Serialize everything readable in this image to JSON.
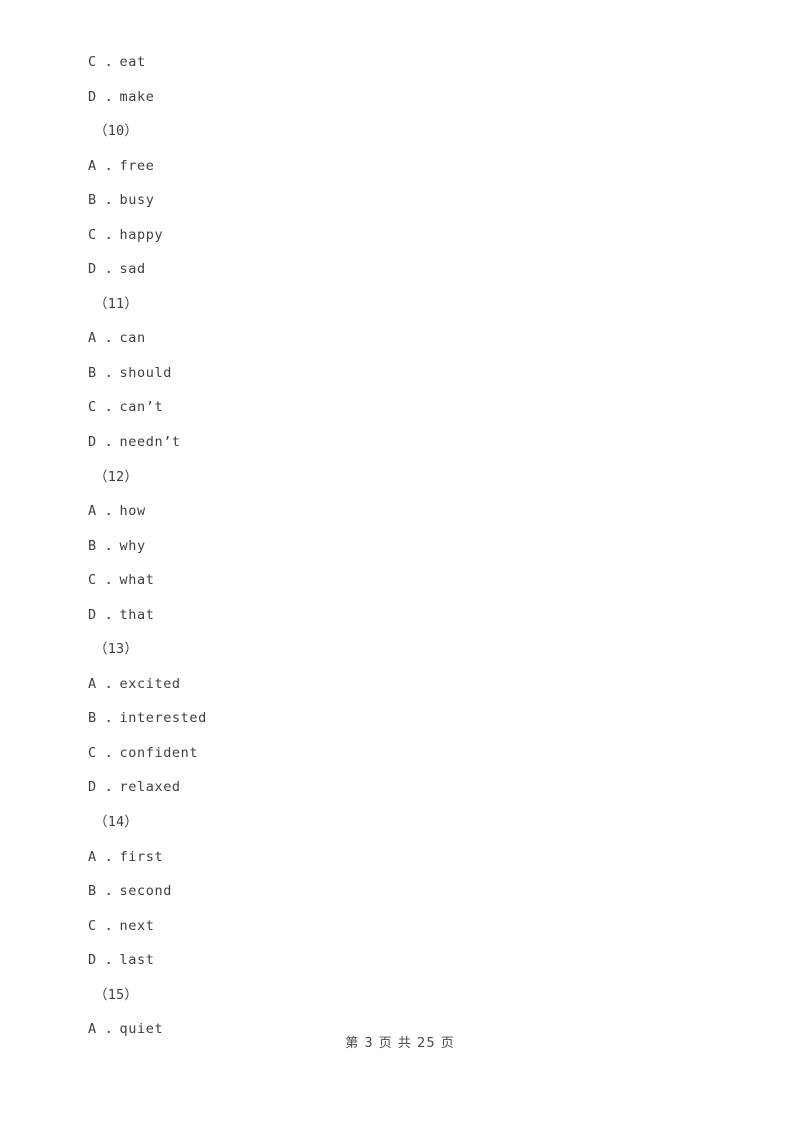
{
  "document": {
    "page_number_footer": "第 3 页 共 25 页"
  },
  "lines": [
    {
      "kind": "option",
      "text": "C ．eat"
    },
    {
      "kind": "option",
      "text": "D ．make"
    },
    {
      "kind": "group",
      "text": "（10）"
    },
    {
      "kind": "option",
      "text": "A ．free"
    },
    {
      "kind": "option",
      "text": "B ．busy"
    },
    {
      "kind": "option",
      "text": "C ．happy"
    },
    {
      "kind": "option",
      "text": "D ．sad"
    },
    {
      "kind": "group",
      "text": "（11）"
    },
    {
      "kind": "option",
      "text": "A ．can"
    },
    {
      "kind": "option",
      "text": "B ．should"
    },
    {
      "kind": "option",
      "text": "C ．can’t"
    },
    {
      "kind": "option",
      "text": "D ．needn’t"
    },
    {
      "kind": "group",
      "text": "（12）"
    },
    {
      "kind": "option",
      "text": "A ．how"
    },
    {
      "kind": "option",
      "text": "B ．why"
    },
    {
      "kind": "option",
      "text": "C ．what"
    },
    {
      "kind": "option",
      "text": "D ．that"
    },
    {
      "kind": "group",
      "text": "（13）"
    },
    {
      "kind": "option",
      "text": "A ．excited"
    },
    {
      "kind": "option",
      "text": "B ．interested"
    },
    {
      "kind": "option",
      "text": "C ．confident"
    },
    {
      "kind": "option",
      "text": "D ．relaxed"
    },
    {
      "kind": "group",
      "text": "（14）"
    },
    {
      "kind": "option",
      "text": "A ．first"
    },
    {
      "kind": "option",
      "text": "B ．second"
    },
    {
      "kind": "option",
      "text": "C ．next"
    },
    {
      "kind": "option",
      "text": "D ．last"
    },
    {
      "kind": "group",
      "text": "（15）"
    },
    {
      "kind": "option",
      "text": "A ．quiet"
    }
  ]
}
